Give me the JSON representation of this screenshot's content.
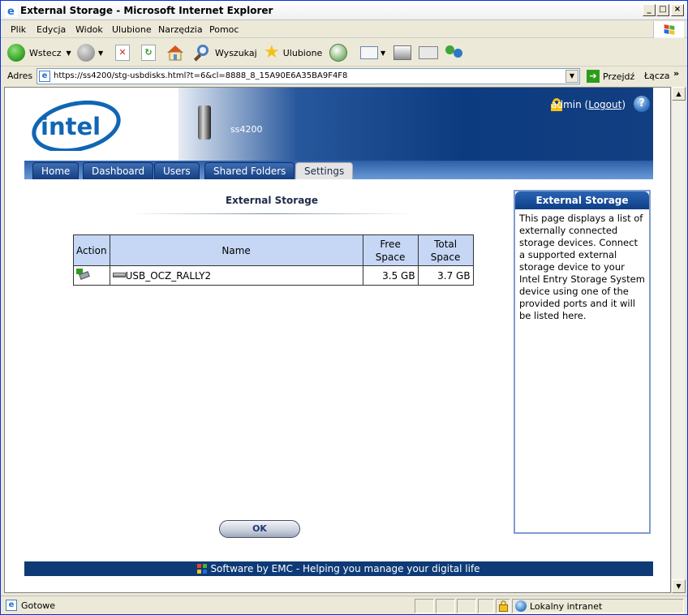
{
  "window": {
    "title": "External Storage - Microsoft Internet Explorer"
  },
  "menu": [
    "Plik",
    "Edycja",
    "Widok",
    "Ulubione",
    "Narzędzia",
    "Pomoc"
  ],
  "toolbar": {
    "back": "Wstecz",
    "search": "Wyszukaj",
    "favorites": "Ulubione"
  },
  "address": {
    "label": "Adres",
    "url": "https://ss4200/stg-usbdisks.html?t=6&cl=8888_8_15A90E6A35BA9F4F8",
    "go": "Przejdź",
    "links": "Łącza"
  },
  "header": {
    "device": "ss4200",
    "user": "admin",
    "logout": "Logout"
  },
  "nav": {
    "tabs": [
      "Home",
      "Dashboard",
      "Users",
      "Shared Folders",
      "Settings"
    ],
    "active": "Settings"
  },
  "main": {
    "title": "External Storage",
    "table": {
      "headers": [
        "Action",
        "Name",
        "Free Space",
        "Total Space"
      ],
      "rows": [
        {
          "name": "USB_OCZ_RALLY2",
          "free": "3.5 GB",
          "total": "3.7 GB"
        }
      ]
    },
    "ok_label": "OK"
  },
  "sidebar": {
    "title": "External Storage",
    "text": "This page displays a list of externally connected storage devices. Connect a supported external storage device to your Intel Entry Storage System device using one of the provided ports and it will be listed here."
  },
  "footer": {
    "text": "Software by EMC - Helping you manage your digital life"
  },
  "status": {
    "left": "Gotowe",
    "zone": "Lokalny intranet"
  }
}
